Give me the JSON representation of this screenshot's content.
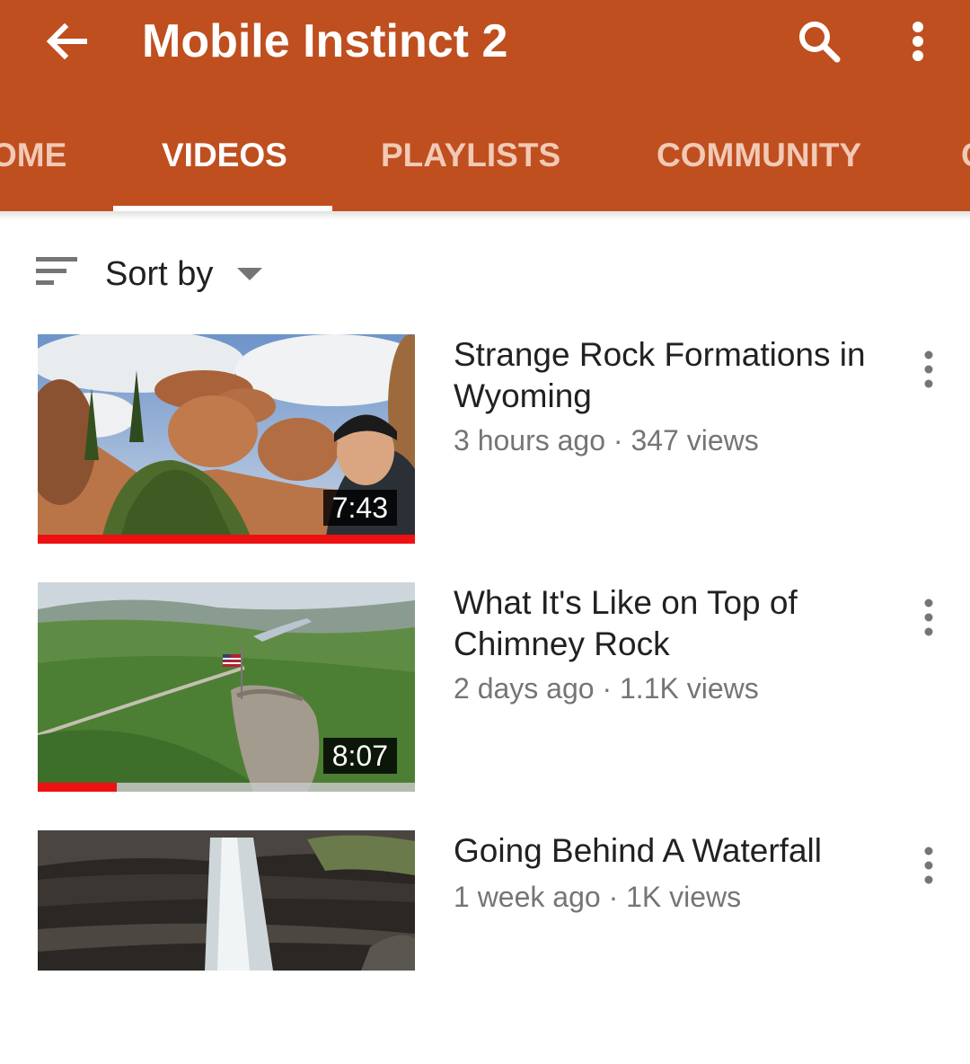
{
  "app_bar": {
    "title": "Mobile Instinct 2",
    "background_color": "#bf4f1f",
    "back_icon": "arrow-left-icon",
    "search_icon": "search-icon",
    "more_icon": "more-vertical-icon"
  },
  "tabs": [
    {
      "label": "HOME",
      "visible_text": "OME",
      "active": false
    },
    {
      "label": "VIDEOS",
      "visible_text": "VIDEOS",
      "active": true
    },
    {
      "label": "PLAYLISTS",
      "visible_text": "PLAYLISTS",
      "active": false
    },
    {
      "label": "COMMUNITY",
      "visible_text": "COMMUNITY",
      "active": false
    },
    {
      "label": "CHANNELS",
      "visible_text": "C",
      "active": false
    }
  ],
  "sort": {
    "label": "Sort by",
    "icon": "sort-icon",
    "dropdown_icon": "caret-down-icon"
  },
  "videos": [
    {
      "title": "Strange Rock Formations in Wyoming",
      "meta": "3 hours ago · 347 views",
      "duration": "7:43",
      "watched_fraction": 1.0
    },
    {
      "title": "What It's Like on Top of Chimney Rock",
      "meta": "2 days ago · 1.1K views",
      "duration": "8:07",
      "watched_fraction": 0.21
    },
    {
      "title": "Going Behind A Waterfall",
      "meta": "1 week ago · 1K views",
      "duration": "",
      "watched_fraction": 0
    }
  ],
  "colors": {
    "progress": "#ee1111",
    "text_primary": "#212121",
    "text_secondary": "#757575"
  }
}
